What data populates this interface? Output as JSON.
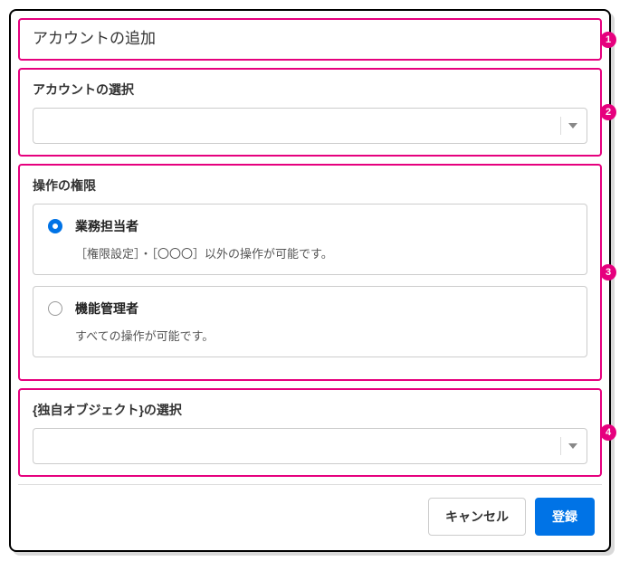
{
  "dialog": {
    "title": "アカウントの追加"
  },
  "account_select": {
    "label": "アカウントの選択",
    "value": ""
  },
  "permissions": {
    "label": "操作の権限",
    "options": [
      {
        "id": "operator",
        "label": "業務担当者",
        "description": "［権限設定］・［〇〇〇］以外の操作が可能です。",
        "selected": true
      },
      {
        "id": "admin",
        "label": "機能管理者",
        "description": "すべての操作が可能です。",
        "selected": false
      }
    ]
  },
  "object_select": {
    "label": "{独自オブジェクト}の選択",
    "value": ""
  },
  "footer": {
    "cancel": "キャンセル",
    "submit": "登録"
  },
  "badges": {
    "b1": "1",
    "b2": "2",
    "b3": "3",
    "b4": "4"
  }
}
